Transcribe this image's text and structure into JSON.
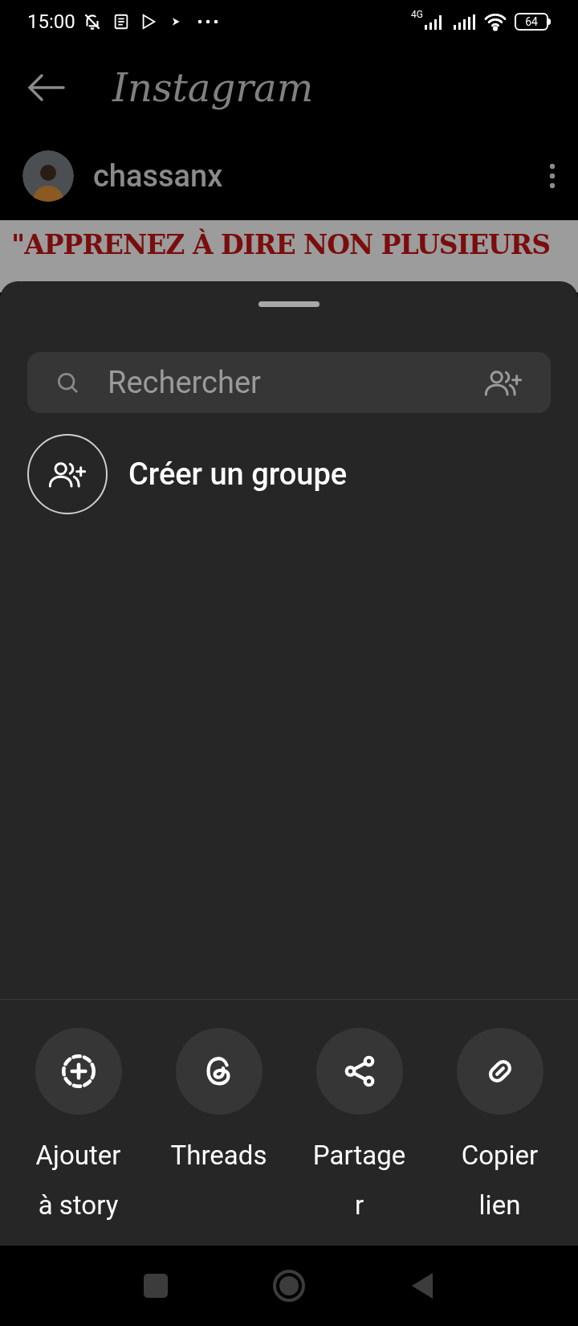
{
  "status_bar": {
    "time": "15:00",
    "network": "4G",
    "battery": "64"
  },
  "header": {
    "title": "Instagram"
  },
  "post": {
    "username": "chassanx",
    "banner_text": "\"APPRENEZ À DIRE NON PLUSIEURS"
  },
  "share_sheet": {
    "search": {
      "placeholder": "Rechercher"
    },
    "create_group": {
      "label": "Créer un groupe"
    },
    "actions": [
      {
        "kind": "story",
        "lines": [
          "Ajouter",
          "à story"
        ]
      },
      {
        "kind": "threads",
        "lines": [
          "Threads"
        ]
      },
      {
        "kind": "share",
        "lines": [
          "Partage",
          "r"
        ]
      },
      {
        "kind": "link",
        "lines": [
          "Copier",
          "lien"
        ]
      }
    ]
  }
}
